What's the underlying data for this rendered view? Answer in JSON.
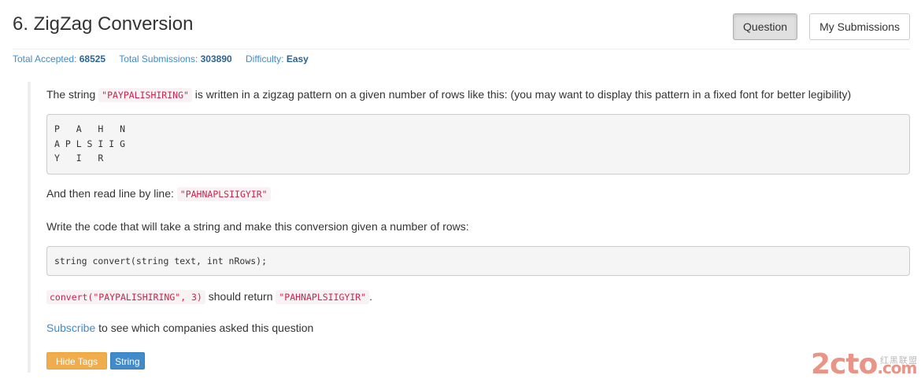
{
  "header": {
    "title": "6. ZigZag Conversion",
    "question_button": "Question",
    "submissions_button": "My Submissions"
  },
  "stats": {
    "accepted_label": "Total Accepted:",
    "accepted_value": "68525",
    "submissions_label": "Total Submissions:",
    "submissions_value": "303890",
    "difficulty_label": "Difficulty:",
    "difficulty_value": "Easy"
  },
  "body": {
    "p1_before": "The string ",
    "p1_code": "\"PAYPALISHIRING\"",
    "p1_after": " is written in a zigzag pattern on a given number of rows like this: (you may want to display this pattern in a fixed font for better legibility)",
    "pattern": "P   A   H   N\nA P L S I I G\nY   I   R",
    "p2_before": "And then read line by line: ",
    "p2_code": "\"PAHNAPLSIIGYIR\"",
    "p3": "Write the code that will take a string and make this conversion given a number of rows:",
    "signature": "string convert(string text, int nRows);",
    "p4_code1": "convert(\"PAYPALISHIRING\", 3)",
    "p4_mid": " should return ",
    "p4_code2": "\"PAHNAPLSIIGYIR\"",
    "p4_end": ".",
    "subscribe_link": "Subscribe",
    "subscribe_rest": " to see which companies asked this question"
  },
  "tags": {
    "hide_label": "Hide Tags",
    "items": [
      "String"
    ]
  },
  "watermark": {
    "main": "2cto",
    "suffix": ".com",
    "small": "红黑联盟"
  },
  "colors": {
    "link": "#428bca",
    "code_text": "#c7254e",
    "code_bg": "#f9f2f4",
    "hide_tags": "#f0ad4e",
    "tag": "#428bca"
  }
}
